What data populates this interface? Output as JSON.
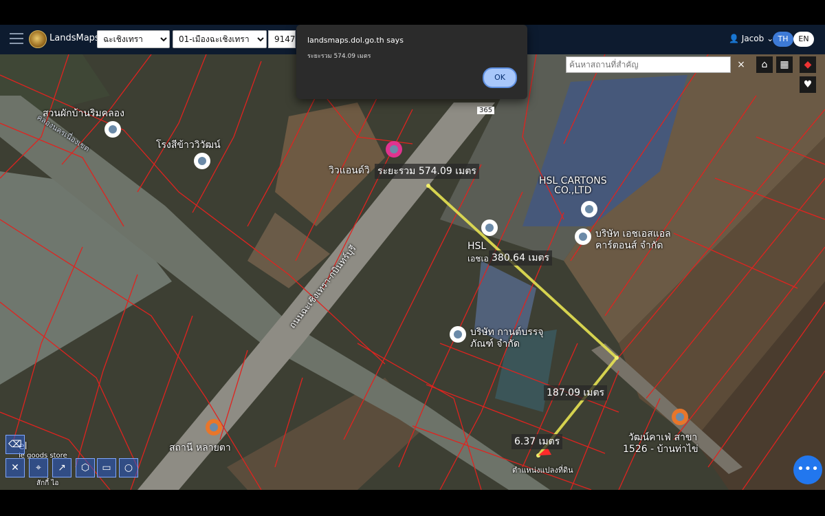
{
  "header": {
    "brand": "LandsMaps",
    "province": "ฉะเชิงเทรา",
    "district": "01-เมืองฉะเชิงเทรา",
    "parcel_no": "9147",
    "user": "Jacob",
    "lang_th": "TH",
    "lang_en": "EN"
  },
  "dialog": {
    "title": "landsmaps.dol.go.th says",
    "message": "ระยะรวม 574.09 เมตร",
    "ok": "OK"
  },
  "search": {
    "placeholder": "ค้นหาสถานที่สำคัญ",
    "clear": "×"
  },
  "map": {
    "labels": {
      "garden": "สวนผักบ้านริมคลอง",
      "canal": "คลองนครเนื่องเขต",
      "rice_mill": "โรงสีข้าววิวัฒน์",
      "vivian": "วิวแอนด์วิ",
      "route": "365",
      "hsl_cartons": "HSL CARTONS\nCO.,LTD",
      "hsl": "HSL",
      "hsl_th1": "บริษัท เอชเอสแอล",
      "hsl_th2": "คาร์ตอนส์ จำกัด",
      "road": "ถนนฉะเชิงเทรา-กบินทร์บุรี",
      "packaging1": "บริษัท กานต์บรรจุ",
      "packaging2": "ภัณฑ์ จำกัด",
      "station": "สถานี หลายตา",
      "cafe1": "วัฒน์คาเฟ่ สาขา",
      "cafe2": "1526 - บ้านท่าไข่",
      "parcel_pos": "ตำแหน่งแปลงที่ดิน",
      "left1": "el",
      "left2": "ie goods store",
      "left3": "สักกี้ ไอ"
    },
    "measurements": {
      "total": "ระยะรวม 574.09 เมตร",
      "seg1_prefix": "เอชเอ",
      "seg1": "380.64 เมตร",
      "seg2": "187.09 เมตร",
      "seg3": "6.37 เมตร"
    }
  }
}
